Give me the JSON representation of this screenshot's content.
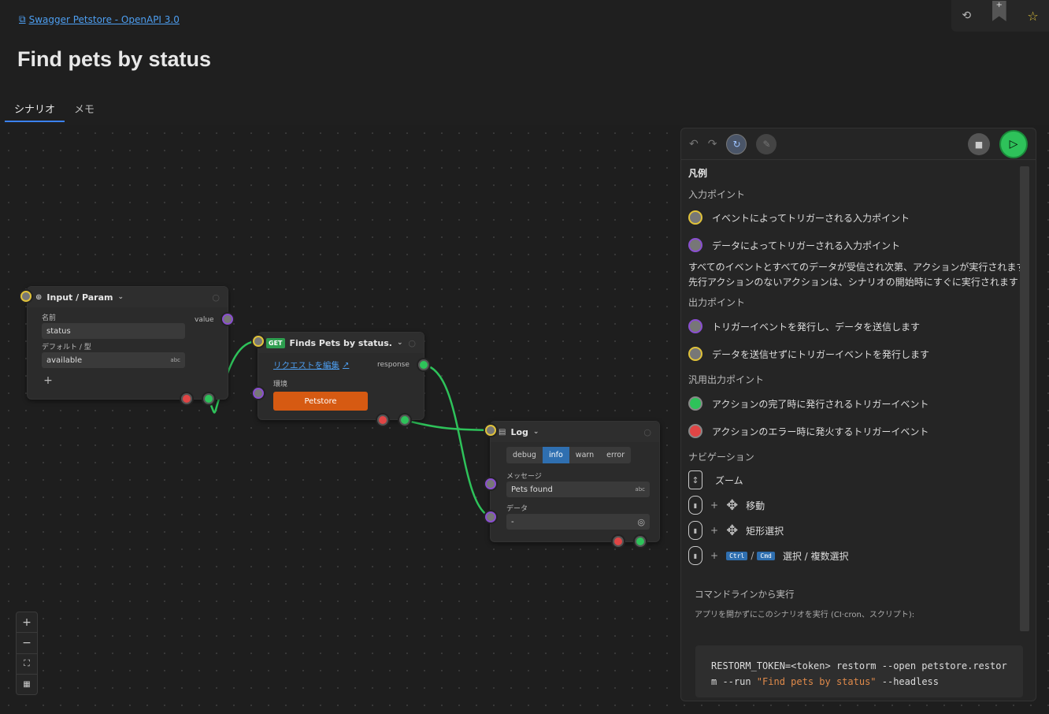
{
  "header": {
    "link": "Swagger Petstore - OpenAPI 3.0",
    "title": "Find pets by status"
  },
  "tabs": [
    {
      "label": "シナリオ",
      "active": true
    },
    {
      "label": "メモ",
      "active": false
    }
  ],
  "nodes": {
    "input": {
      "title": "Input / Param",
      "name_label": "名前",
      "name_value": "status",
      "default_label": "デフォルト / 型",
      "default_value": "available",
      "type_badge": "abc",
      "output_label": "value"
    },
    "get": {
      "method": "GET",
      "title": "Finds Pets by status.",
      "edit_link": "リクエストを編集",
      "env_label": "環境",
      "env_button": "Petstore",
      "output_label": "response"
    },
    "log": {
      "title": "Log",
      "levels": [
        "debug",
        "info",
        "warn",
        "error"
      ],
      "active_level": "info",
      "message_label": "メッセージ",
      "message_value": "Pets found",
      "type_badge": "abc",
      "data_label": "データ",
      "data_value": "-"
    }
  },
  "legend": {
    "title": "凡例",
    "input_points": "入力ポイント",
    "event_input": "イベントによってトリガーされる入力ポイント",
    "data_input": "データによってトリガーされる入力ポイント",
    "note1": "すべてのイベントとすべてのデータが受信され次第、アクションが実行されます",
    "note2": "先行アクションのないアクションは、シナリオの開始時にすぐに実行されます",
    "output_points": "出力ポイント",
    "out_trigger_data": "トリガーイベントを発行し、データを送信します",
    "out_trigger_only": "データを送信せずにトリガーイベントを発行します",
    "generic_output": "汎用出力ポイント",
    "on_complete": "アクションの完了時に発行されるトリガーイベント",
    "on_error": "アクションのエラー時に発火するトリガーイベント",
    "navigation": "ナビゲーション",
    "zoom": "ズーム",
    "move": "移動",
    "rect_select": "矩形選択",
    "plus": "+",
    "slash": "/",
    "ctrl": "Ctrl",
    "cmd": "Cmd",
    "multi_select": "選択 / 複数選択",
    "cli_title": "コマンドラインから実行",
    "cli_desc": "アプリを開かずにこのシナリオを実行 (CI·cron、スクリプト):",
    "cli_cmd_a": "RESTORM_TOKEN=<token> restorm --open petstore.restorm --run ",
    "cli_cmd_str": "\"Find pets by status\"",
    "cli_cmd_b": " --headless"
  },
  "colors": {
    "accent": "#3b82f6",
    "run": "#2ec25a",
    "edge": "#2ec25a",
    "error": "#e04545",
    "env": "#d65a12"
  }
}
